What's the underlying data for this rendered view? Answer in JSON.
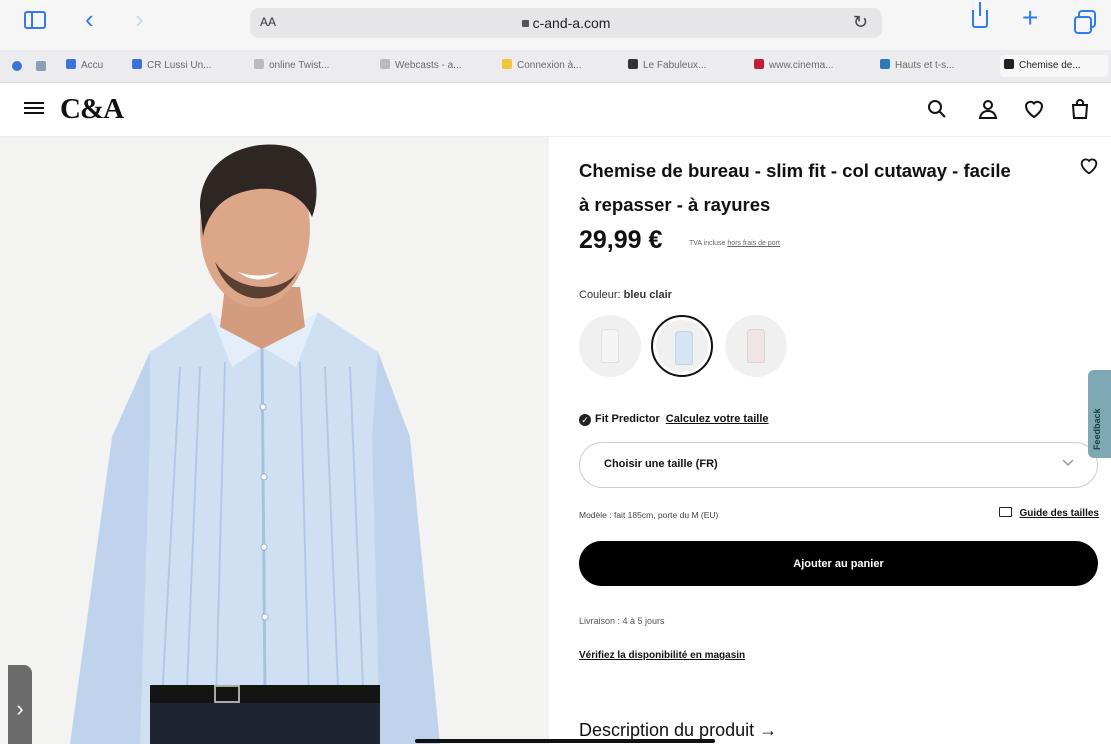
{
  "browser": {
    "aa_label": "AA",
    "url": "c-and-a.com",
    "tabs": [
      {
        "label": "Accu",
        "color": "#3b73d8"
      },
      {
        "label": "CR Lussi Un...",
        "color": "#3b73d8"
      },
      {
        "label": "online Twist...",
        "color": "#bbbbbb"
      },
      {
        "label": "Webcasts - a...",
        "color": "#bbbbbb"
      },
      {
        "label": "Connexion à...",
        "color": "#f4c542"
      },
      {
        "label": "Le Fabuleux...",
        "color": "#333333"
      },
      {
        "label": "www.cinema...",
        "color": "#c0203b"
      },
      {
        "label": "Hauts et t-s...",
        "color": "#2a7ab8"
      },
      {
        "label": "Chemise de...",
        "color": "#222222"
      }
    ]
  },
  "header": {
    "logo": "C&A"
  },
  "product": {
    "title": "Chemise de bureau - slim fit - col cutaway - facile à repasser - à rayures",
    "price": "29,99 €",
    "price_note": "TVA incluse",
    "price_note_link": "hors frais de port",
    "color_label": "Couleur:",
    "color_value": "bleu clair",
    "swatches": [
      {
        "name": "white",
        "color": "#f4f4f4",
        "selected": false
      },
      {
        "name": "light-blue",
        "color": "#d4e6f6",
        "selected": true
      },
      {
        "name": "pink",
        "color": "#f0e4e4",
        "selected": false
      }
    ],
    "fit_predictor": "Fit Predictor",
    "fit_link": "Calculez votre taille",
    "size_placeholder": "Choisir une taille (FR)",
    "model_info": "Modèle : fait 185cm, porte du M (EU)",
    "size_guide": "Guide des tailles",
    "add_to_cart": "Ajouter au panier",
    "delivery": "Livraison : 4 à 5 jours",
    "store_check": "Vérifiez la disponibilité en magasin",
    "description_title": "Description du produit",
    "description_arrow": "→"
  },
  "feedback": "Feedback"
}
